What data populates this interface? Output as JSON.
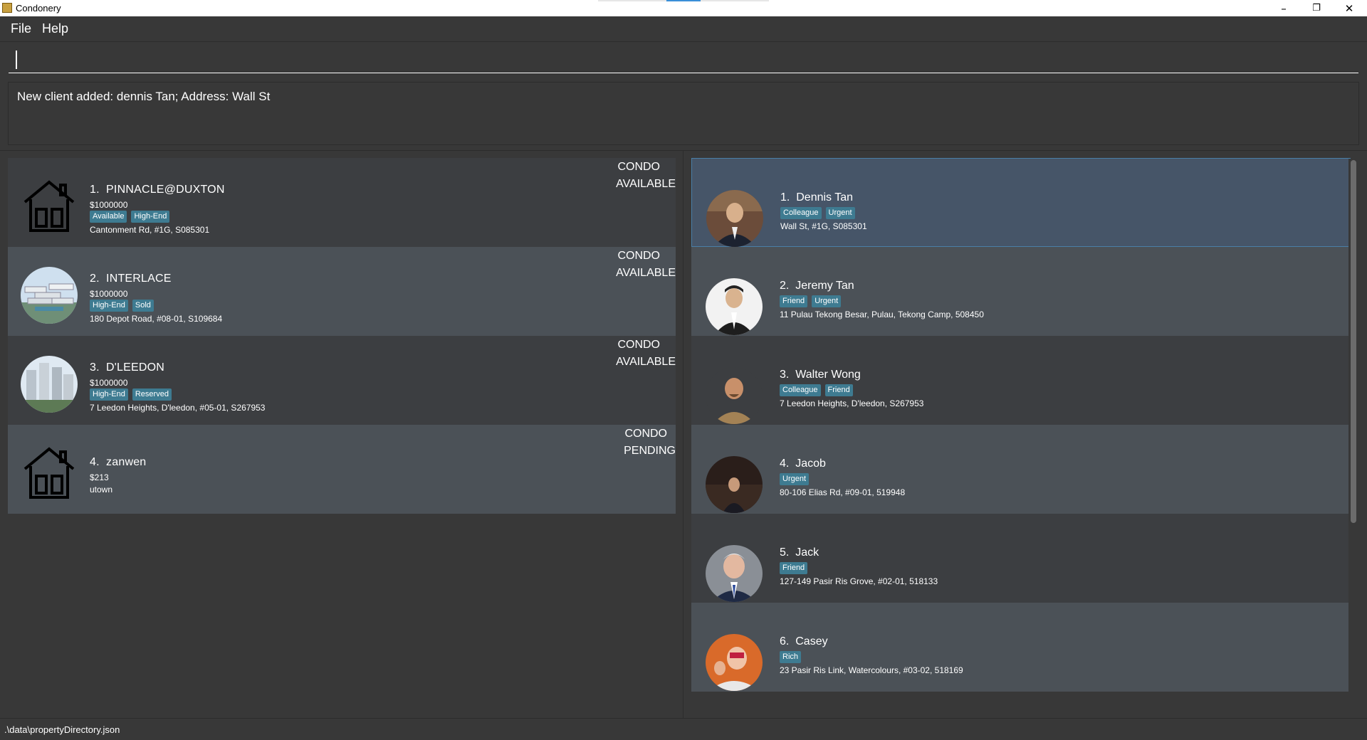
{
  "window": {
    "title": "Condonery"
  },
  "menu": {
    "file": "File",
    "help": "Help"
  },
  "command": {
    "value": ""
  },
  "result": {
    "message": "New client added: dennis Tan; Address: Wall St"
  },
  "properties": [
    {
      "index": "1.",
      "name": "PINNACLE@DUXTON",
      "price": "$1000000",
      "tags": [
        "Available",
        "High-End"
      ],
      "address": "Cantonment Rd, #1G, S085301",
      "type": "CONDO",
      "status": "AVAILABLE",
      "image": "house-icon"
    },
    {
      "index": "2.",
      "name": "INTERLACE",
      "price": "$1000000",
      "tags": [
        "High-End",
        "Sold"
      ],
      "address": "180 Depot Road, #08-01, S109684",
      "type": "CONDO",
      "status": "AVAILABLE",
      "image": "building-photo"
    },
    {
      "index": "3.",
      "name": "D'LEEDON",
      "price": "$1000000",
      "tags": [
        "High-End",
        "Reserved"
      ],
      "address": "7 Leedon Heights, D'leedon, #05-01, S267953",
      "type": "CONDO",
      "status": "AVAILABLE",
      "image": "tower-photo"
    },
    {
      "index": "4.",
      "name": "zanwen",
      "price": "$213",
      "tags": [],
      "address": "utown",
      "type": "CONDO",
      "status": "PENDING",
      "image": "house-icon"
    }
  ],
  "clients": [
    {
      "index": "1.",
      "name": "Dennis Tan",
      "tags": [
        "Colleague",
        "Urgent"
      ],
      "address": "Wall St, #1G, S085301"
    },
    {
      "index": "2.",
      "name": "Jeremy Tan",
      "tags": [
        "Friend",
        "Urgent"
      ],
      "address": "11 Pulau Tekong Besar, Pulau, Tekong Camp, 508450"
    },
    {
      "index": "3.",
      "name": "Walter Wong",
      "tags": [
        "Colleague",
        "Friend"
      ],
      "address": "7 Leedon Heights, D'leedon, S267953"
    },
    {
      "index": "4.",
      "name": "Jacob",
      "tags": [
        "Urgent"
      ],
      "address": "80-106 Elias Rd, #09-01, 519948"
    },
    {
      "index": "5.",
      "name": "Jack",
      "tags": [
        "Friend"
      ],
      "address": "127-149 Pasir Ris Grove, #02-01, 518133"
    },
    {
      "index": "6.",
      "name": "Casey",
      "tags": [
        "Rich"
      ],
      "address": "23 Pasir Ris Link, Watercolours, #03-02, 518169"
    }
  ],
  "status": {
    "path": ".\\data\\propertyDirectory.json"
  },
  "colors": {
    "tag": "#3e7b91",
    "selected": "#465568",
    "background": "#383838"
  }
}
